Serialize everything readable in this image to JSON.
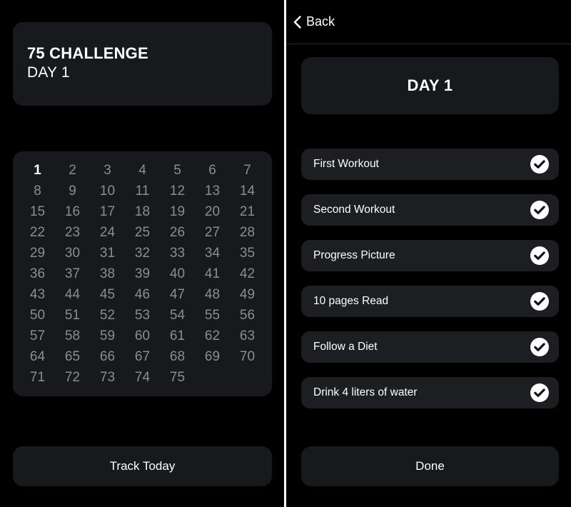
{
  "theme": {
    "background": "#000000",
    "card_background": "#17191d",
    "row_background": "#1c1e22",
    "text_primary": "#ffffff",
    "text_muted": "#8b8d91",
    "divider": "#ffffff"
  },
  "left_screen": {
    "header_card": {
      "title": "75 CHALLENGE",
      "subtitle": "DAY 1"
    },
    "calendar": {
      "current_day": 1,
      "total_days": 75,
      "days": [
        1,
        2,
        3,
        4,
        5,
        6,
        7,
        8,
        9,
        10,
        11,
        12,
        13,
        14,
        15,
        16,
        17,
        18,
        19,
        20,
        21,
        22,
        23,
        24,
        25,
        26,
        27,
        28,
        29,
        30,
        31,
        32,
        33,
        34,
        35,
        36,
        37,
        38,
        39,
        40,
        41,
        42,
        43,
        44,
        45,
        46,
        47,
        48,
        49,
        50,
        51,
        52,
        53,
        54,
        55,
        56,
        57,
        58,
        59,
        60,
        61,
        62,
        63,
        64,
        65,
        66,
        67,
        68,
        69,
        70,
        71,
        72,
        73,
        74,
        75
      ]
    },
    "primary_button": {
      "label": "Track Today"
    }
  },
  "right_screen": {
    "nav": {
      "back_label": "Back",
      "back_icon": "chevron-left-icon"
    },
    "day_card": {
      "label": "DAY 1"
    },
    "tasks": [
      {
        "label": "First Workout",
        "checked": true,
        "icon": "check-circle-icon"
      },
      {
        "label": "Second Workout",
        "checked": true,
        "icon": "check-circle-icon"
      },
      {
        "label": "Progress Picture",
        "checked": true,
        "icon": "check-circle-icon"
      },
      {
        "label": "10 pages Read",
        "checked": true,
        "icon": "check-circle-icon"
      },
      {
        "label": "Follow a Diet",
        "checked": true,
        "icon": "check-circle-icon"
      },
      {
        "label": "Drink 4 liters of water",
        "checked": true,
        "icon": "check-circle-icon"
      }
    ],
    "primary_button": {
      "label": "Done"
    }
  }
}
